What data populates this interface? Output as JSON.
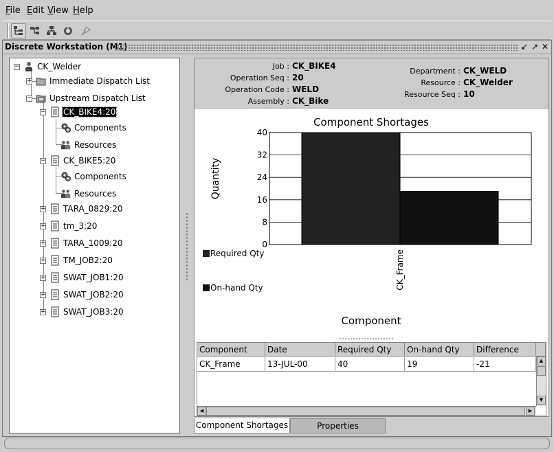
{
  "menubar": {
    "items": [
      {
        "label": "File",
        "mnemonic": "F",
        "rest": "ile"
      },
      {
        "label": "Edit",
        "mnemonic": "E",
        "rest": "dit"
      },
      {
        "label": "View",
        "mnemonic": "V",
        "rest": "iew"
      },
      {
        "label": "Help",
        "mnemonic": "H",
        "rest": "elp"
      }
    ]
  },
  "toolbar": {
    "icons": [
      "tree-view-icon",
      "tree-expand-icon",
      "tree-collapse-icon",
      "database-icon",
      "pin-icon"
    ]
  },
  "window": {
    "title": "Discrete Workstation (M1)",
    "controls": [
      "minimize-icon",
      "maximize-icon",
      "close-icon"
    ]
  },
  "tree": {
    "root": "CK_Welder",
    "immediate": "Immediate Dispatch List",
    "upstream": "Upstream Dispatch List",
    "jobs": [
      {
        "label": "CK_BIKE4:20",
        "selected": true,
        "children": [
          "Components",
          "Resources"
        ]
      },
      {
        "label": "CK_BIKE5:20",
        "selected": false,
        "children": [
          "Components",
          "Resources"
        ]
      },
      {
        "label": "TARA_0829:20"
      },
      {
        "label": "tm_3:20"
      },
      {
        "label": "TARA_1009:20"
      },
      {
        "label": "TM_JOB2:20"
      },
      {
        "label": "SWAT_JOB1:20"
      },
      {
        "label": "SWAT_JOB2:20"
      },
      {
        "label": "SWAT_JOB3:20"
      }
    ]
  },
  "header": {
    "job_label": "Job :",
    "job": "CK_BIKE4",
    "opseq_label": "Operation Seq :",
    "opseq": "20",
    "opcode_label": "Operation Code :",
    "opcode": "WELD",
    "assembly_label": "Assembly :",
    "assembly": "CK_Bike",
    "dept_label": "Department :",
    "dept": "CK_WELD",
    "resource_label": "Resource :",
    "resource": "CK_Welder",
    "resseq_label": "Resource Seq :",
    "resseq": "10"
  },
  "chart_data": {
    "type": "bar",
    "title": "Component Shortages",
    "xlabel": "Component",
    "ylabel": "Quantity",
    "categories": [
      "CK_Frame"
    ],
    "series": [
      {
        "name": "Required Qty",
        "values": [
          40
        ],
        "color": "#222222"
      },
      {
        "name": "On-hand Qty",
        "values": [
          19
        ],
        "color": "#111111"
      }
    ],
    "ylim": [
      0,
      40
    ],
    "yticks": [
      "0",
      "8",
      "16",
      "24",
      "32",
      "40"
    ],
    "grid": true,
    "legend": "left"
  },
  "table": {
    "columns": [
      "Component",
      "Date",
      "Required Qty",
      "On-hand Qty",
      "Difference"
    ],
    "rows": [
      [
        "CK_Frame",
        "13-JUL-00",
        "40",
        "19",
        "-21"
      ]
    ]
  },
  "tabs": [
    {
      "label": "Component Shortages",
      "active": true
    },
    {
      "label": "Properties",
      "active": false
    }
  ]
}
